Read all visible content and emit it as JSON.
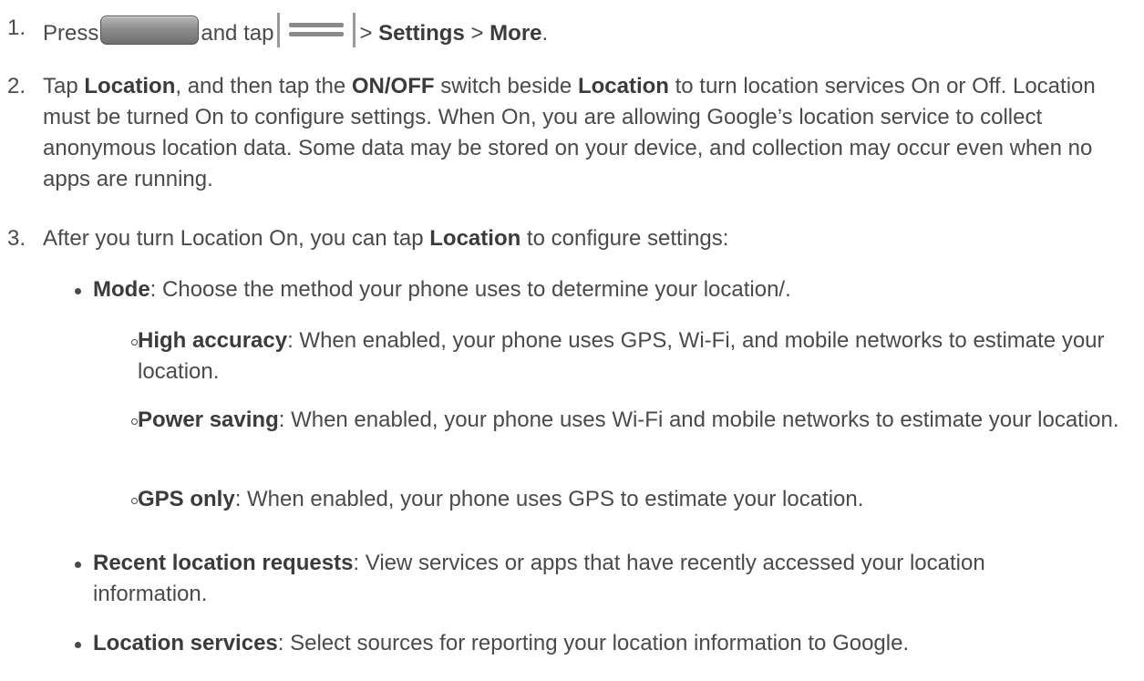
{
  "steps": [
    {
      "num": "1.",
      "pre": "Press",
      "mid": "and tap",
      "sep1": ">",
      "b1": "Settings",
      "sep2": ">",
      "b2": "More",
      "end": "."
    },
    {
      "num": "2.",
      "t1": "Tap ",
      "b1": "Location",
      "t2": ", and then tap the ",
      "b2": "ON/OFF",
      "t3": " switch beside ",
      "b3": "Location",
      "t4": " to turn location services On or Off. Location must be turned On to configure settings. When On, you are allowing Google’s location service to collect anonymous location data. Some data may be stored on your device, and collection may occur even when no apps are running."
    },
    {
      "num": "3.",
      "t1": "After you turn Location On, you can tap ",
      "b1": "Location",
      "t2": " to configure settings:"
    }
  ],
  "items": {
    "mode": {
      "b": "Mode",
      "t": ": Choose the method your phone uses to determine your location/."
    },
    "high": {
      "b": "High accuracy",
      "t": ": When enabled, your phone uses GPS, Wi-Fi, and mobile networks to estimate your location."
    },
    "power": {
      "b": "Power saving",
      "t": ": When enabled, your phone uses Wi-Fi and mobile networks to estimate your location."
    },
    "gps": {
      "b": "GPS only",
      "t": ": When enabled, your phone uses GPS to estimate your location."
    },
    "recent": {
      "b": "Recent location requests",
      "t": ": View services or apps that have recently accessed your location information."
    },
    "services": {
      "b": "Location services",
      "t": ": Select sources for reporting your location information to Google."
    }
  },
  "icons": {
    "home": "home-button-icon",
    "menu": "menu-button-icon"
  }
}
